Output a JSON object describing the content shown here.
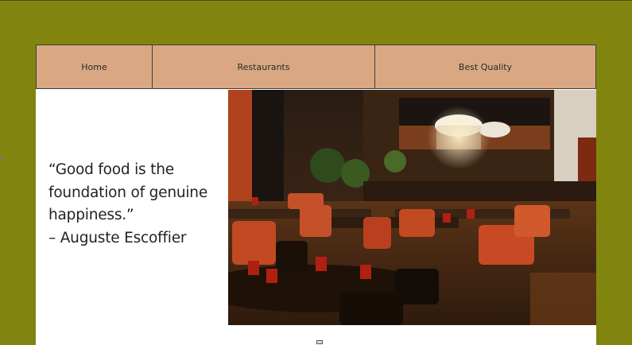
{
  "nav": {
    "items": [
      {
        "label": "Home"
      },
      {
        "label": "Restaurants"
      },
      {
        "label": "Best Quality"
      }
    ]
  },
  "hero": {
    "quote_lines": [
      "“Good food is the",
      "foundation of genuine",
      "happiness.”",
      "– Auguste Escoffier"
    ],
    "image": "restaurant-interior-photo"
  },
  "colors": {
    "background": "#818510",
    "nav_background": "#d9a882",
    "text": "#222222"
  }
}
